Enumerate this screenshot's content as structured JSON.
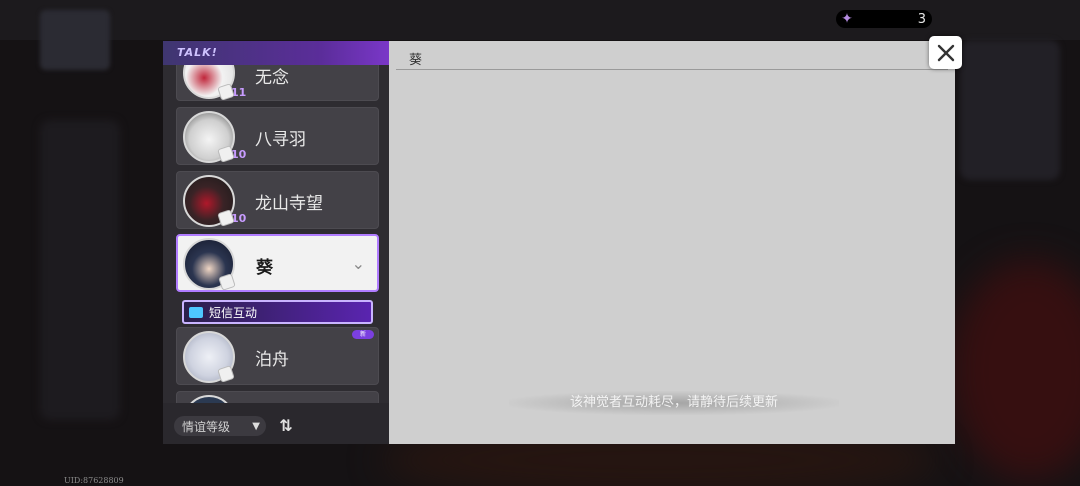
{
  "header": {
    "logo_text": "TALK!",
    "currency_count": "3",
    "currency_icon": "crane-bird-icon"
  },
  "contacts": [
    {
      "name": "无念",
      "level": "11",
      "selected": false,
      "is_new": false
    },
    {
      "name": "八寻羽",
      "level": "10",
      "selected": false,
      "is_new": false
    },
    {
      "name": "龙山寺望",
      "level": "10",
      "selected": false,
      "is_new": false
    },
    {
      "name": "葵",
      "level": "",
      "selected": true,
      "is_new": false
    },
    {
      "name": "泊舟",
      "level": "",
      "selected": false,
      "is_new": true
    }
  ],
  "sub_item": {
    "label": "短信互动",
    "icon": "message-icon"
  },
  "new_badge": "新",
  "filter": {
    "selected": "情谊等级",
    "sort_icon": "sort-arrows-icon"
  },
  "chat": {
    "title": "葵",
    "notice": "该神觉者互动耗尽，请静待后续更新"
  },
  "footer": {
    "uid": "UID:87628809"
  },
  "colors": {
    "accent": "#7a37c8",
    "panel": "#2e2c31",
    "chat_bg": "#cfcfcf"
  }
}
